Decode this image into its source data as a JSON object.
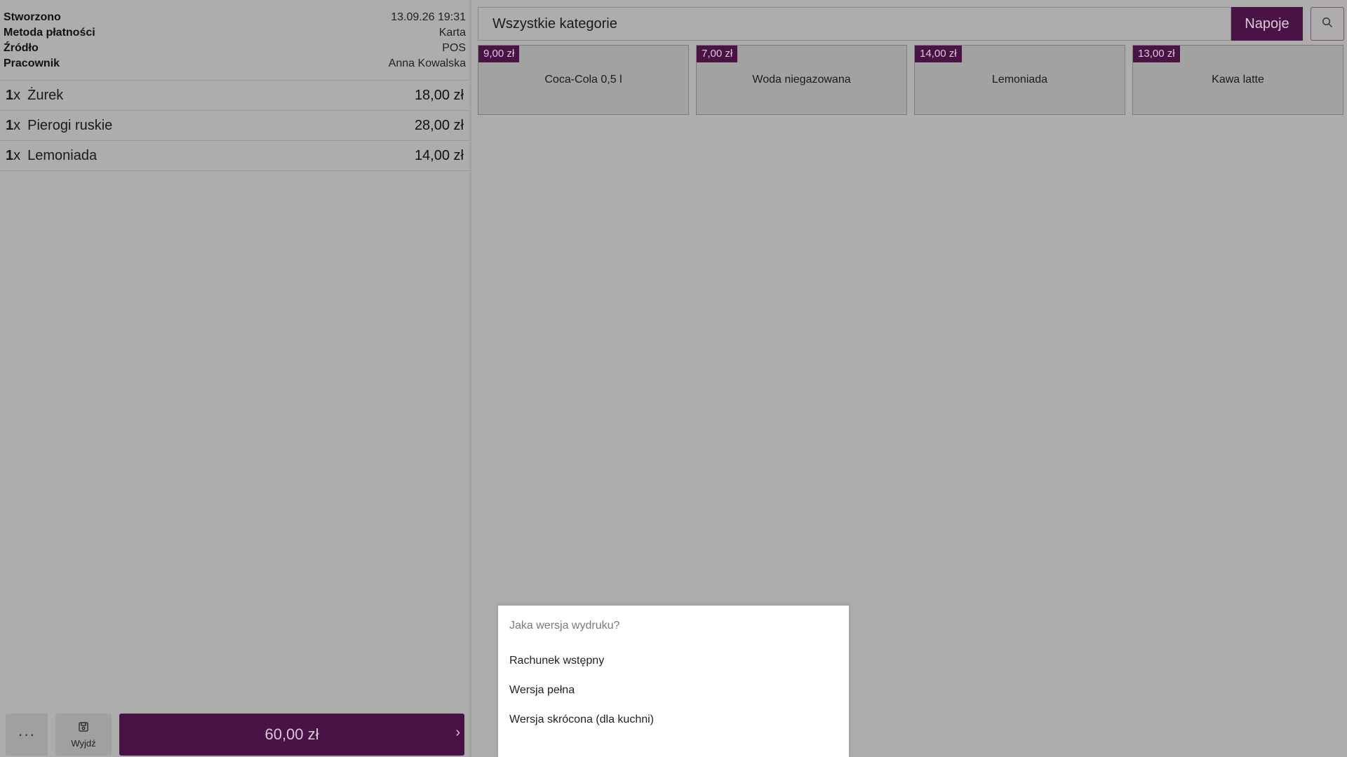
{
  "order_info": {
    "created_label": "Stworzono",
    "created_value": "13.09.26 19:31",
    "payment_label": "Metoda płatności",
    "payment_value": "Karta",
    "source_label": "Źródło",
    "source_value": "POS",
    "employee_label": "Pracownik",
    "employee_value": "Anna Kowalska"
  },
  "order_lines": [
    {
      "qty": "1",
      "x": "x",
      "name": "Żurek",
      "price": "18,00 zł"
    },
    {
      "qty": "1",
      "x": "x",
      "name": "Pierogi ruskie",
      "price": "28,00 zł"
    },
    {
      "qty": "1",
      "x": "x",
      "name": "Lemoniada",
      "price": "14,00 zł"
    }
  ],
  "bottom_bar": {
    "more_label": "···",
    "exit_label": "Wyjdź",
    "total": "60,00 zł",
    "chevron": "›"
  },
  "categories": {
    "current": "Wszystkie kategorie",
    "tab": "Napoje",
    "search_icon": "search-icon"
  },
  "products": [
    {
      "price": "9,00 zł",
      "name": "Coca-Cola 0,5 l"
    },
    {
      "price": "7,00 zł",
      "name": "Woda niegazowana"
    },
    {
      "price": "14,00 zł",
      "name": "Lemoniada"
    },
    {
      "price": "13,00 zł",
      "name": "Kawa latte"
    }
  ],
  "print_menu": {
    "title": "Jaka wersja wydruku?",
    "options": [
      "Rachunek wstępny",
      "Wersja pełna",
      "Wersja skrócona (dla kuchni)"
    ]
  },
  "colors": {
    "accent": "#4a1346",
    "background": "#adadad",
    "popup": "#ffffff"
  }
}
